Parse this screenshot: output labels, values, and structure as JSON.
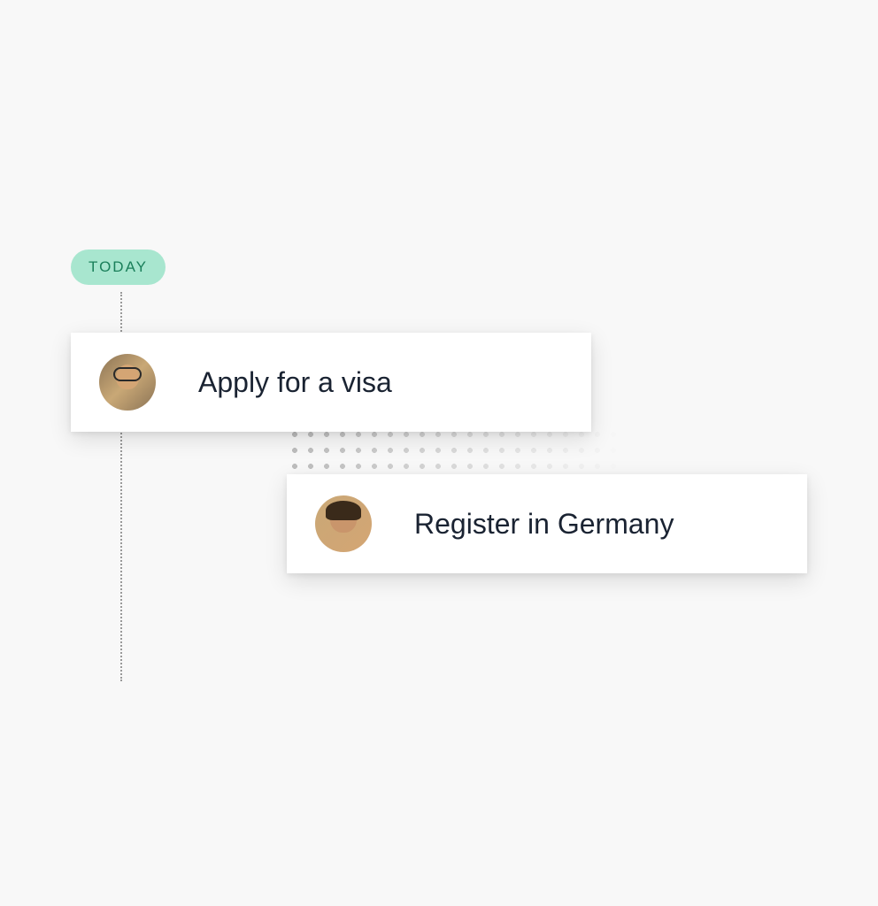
{
  "timeline": {
    "badge_label": "TODAY",
    "tasks": [
      {
        "title": "Apply for a visa",
        "avatar_name": "avatar-person-1"
      },
      {
        "title": "Register in Germany",
        "avatar_name": "avatar-person-2"
      }
    ]
  },
  "colors": {
    "badge_bg": "#a8e6cf",
    "badge_text": "#1a7f5a",
    "card_bg": "#ffffff",
    "page_bg": "#f8f8f8",
    "text": "#1a2332"
  }
}
